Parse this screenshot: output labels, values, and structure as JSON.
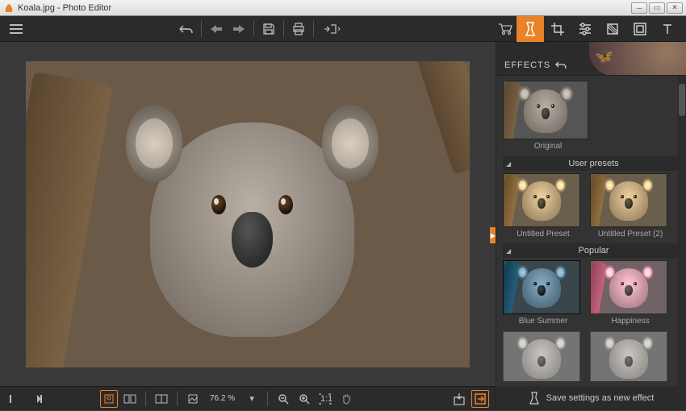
{
  "window": {
    "title": "Koala.jpg - Photo Editor"
  },
  "toolbar": {
    "menu": "menu-icon",
    "undo": "undo-icon",
    "back": "back-icon",
    "forward": "forward-icon",
    "save": "save-icon",
    "print": "print-icon",
    "export": "export-icon",
    "cart": "cart-icon"
  },
  "rightTools": {
    "effects": "flask-icon",
    "crop": "crop-icon",
    "adjust": "sliders-icon",
    "retouch": "retouch-icon",
    "frames": "frames-icon",
    "text": "text-icon"
  },
  "panel": {
    "label": "EFFECTS",
    "undo": "undo-icon",
    "original": "Original",
    "sections": {
      "userPresets": {
        "title": "User presets",
        "items": [
          "Untitled Preset",
          "Untitled Preset (2)"
        ]
      },
      "popular": {
        "title": "Popular",
        "items": [
          "Blue Summer",
          "Happiness"
        ]
      }
    },
    "saveEffect": "Save settings as new effect"
  },
  "bottombar": {
    "zoom": "76.2 %"
  }
}
